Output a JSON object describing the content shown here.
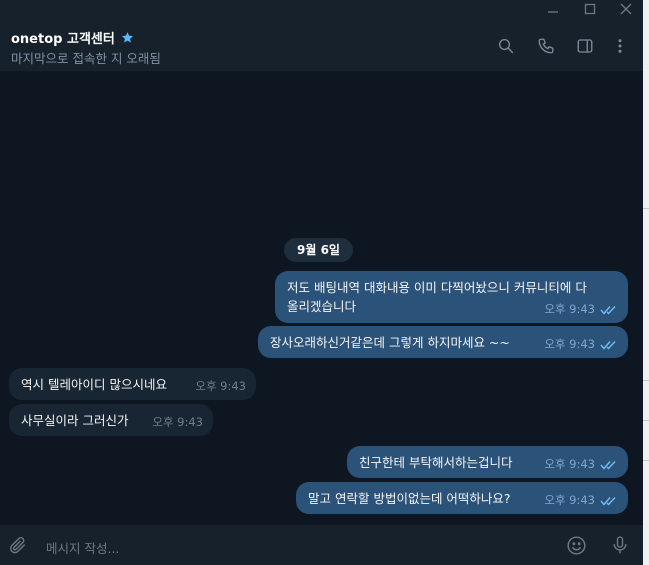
{
  "header": {
    "title": "onetop 고객센터",
    "status": "마지막으로 접속한 지 오래됨"
  },
  "date_label": "9월 6일",
  "messages": [
    {
      "dir": "out",
      "text_lines": [
        "저도 배팅내역 대화내용 이미 다찍어놨으니 커뮤니티에 다",
        "올리겠습니다"
      ],
      "time": "오후 9:43",
      "read": true
    },
    {
      "dir": "out",
      "text": "장사오래하신거같은데 그렇게 하지마세요 ~~",
      "time": "오후 9:43",
      "read": true
    },
    {
      "dir": "in",
      "text": "역시 텔레아이디 많으시네요",
      "time": "오후 9:43"
    },
    {
      "dir": "in",
      "text": "사무실이라 그러신가",
      "time": "오후 9:43"
    },
    {
      "dir": "out",
      "text": "친구한테 부탁해서하는겁니다",
      "time": "오후 9:43",
      "read": true
    },
    {
      "dir": "out",
      "text": "말고 연락할 방법이없는데 어떡하나요?",
      "time": "오후 9:43",
      "read": true
    }
  ],
  "composer": {
    "placeholder": "메시지 작성..."
  },
  "icons": {
    "header": [
      "search-icon",
      "phone-icon",
      "sidebar-toggle-icon",
      "more-vertical-icon"
    ],
    "window": [
      "minimize-icon",
      "maximize-icon",
      "close-icon"
    ],
    "composer": [
      "attach-icon",
      "emoji-icon",
      "microphone-icon"
    ],
    "title": "star-icon"
  },
  "colors": {
    "background": "#0e1621",
    "panel": "#17212b",
    "outgoing_bubble": "#2b5278",
    "incoming_bubble": "#182533",
    "accent": "#5eb5f7"
  }
}
